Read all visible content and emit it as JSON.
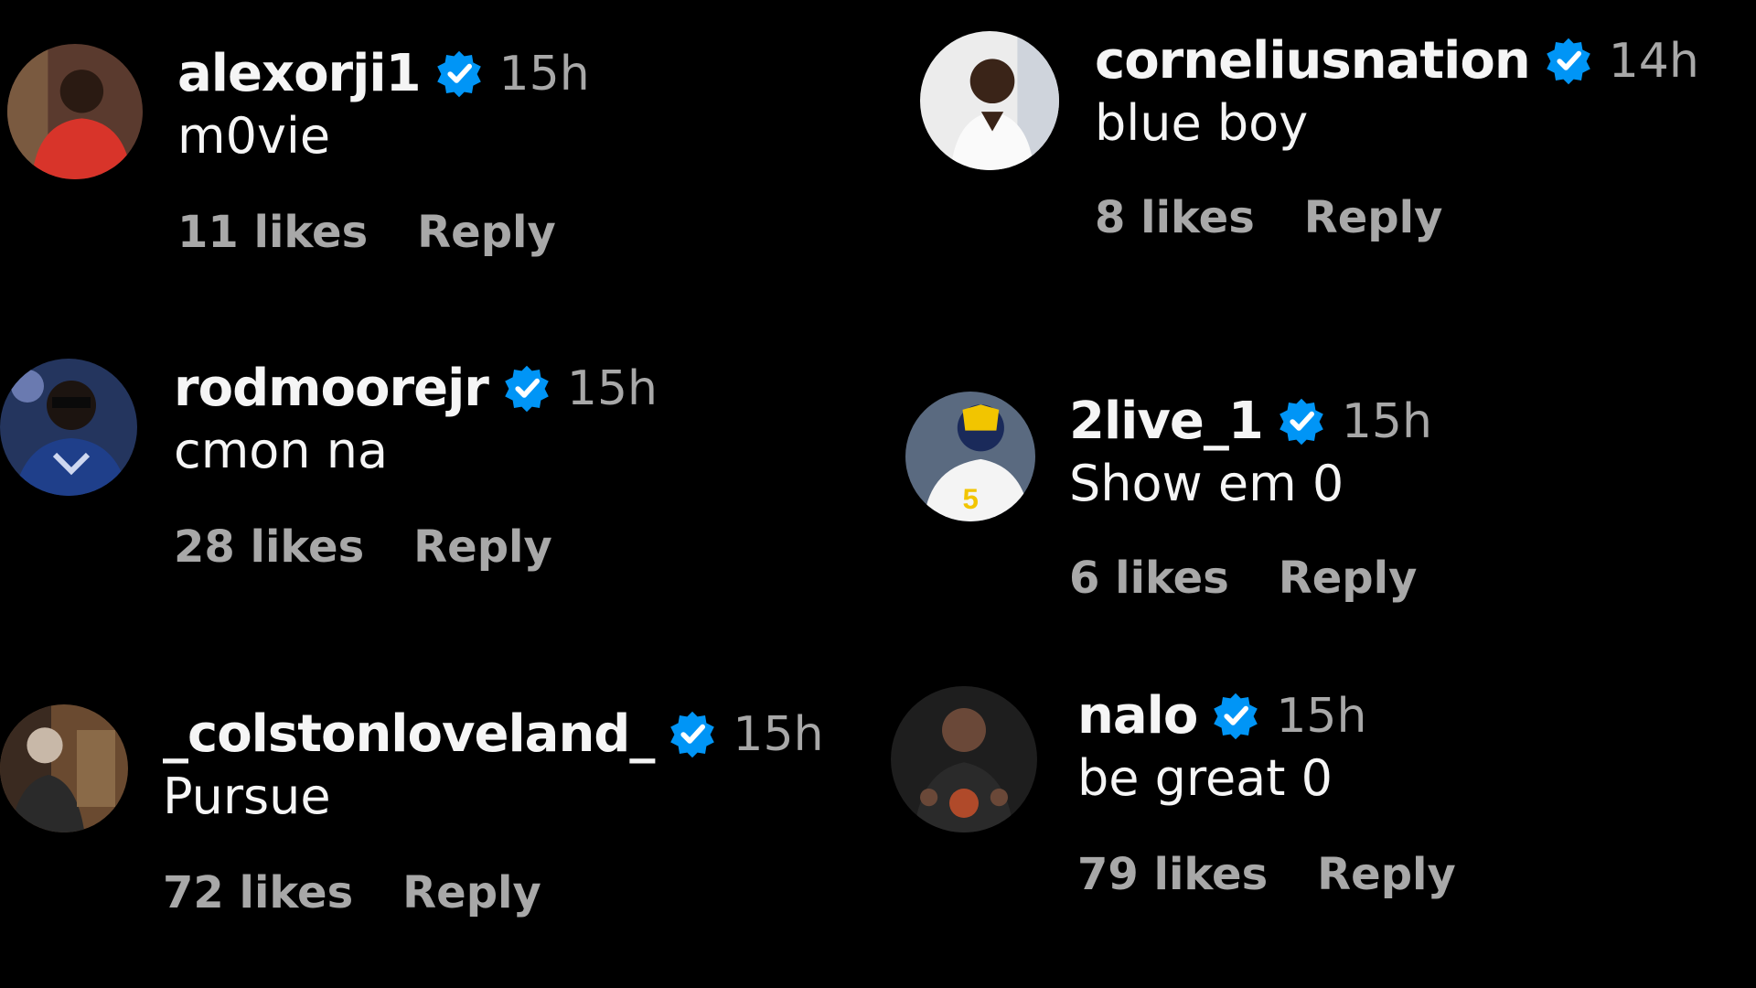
{
  "colors": {
    "background": "#000000",
    "text_primary": "#f5f5f5",
    "text_secondary": "#a8a8a8",
    "verified_blue": "#0095f6"
  },
  "comments": [
    {
      "username": "alexorji1",
      "verified_icon": "verified-badge-icon",
      "time": "15h",
      "text": "m0vie",
      "likes": "11 likes",
      "reply_label": "Reply"
    },
    {
      "username": "rodmoorejr",
      "verified_icon": "verified-badge-icon",
      "time": "15h",
      "text": "cmon na",
      "likes": "28 likes",
      "reply_label": "Reply"
    },
    {
      "username": "_colstonloveland_",
      "verified_icon": "verified-badge-icon",
      "time": "15h",
      "text": "Pursue",
      "likes": "72 likes",
      "reply_label": "Reply"
    },
    {
      "username": "corneliusnation",
      "verified_icon": "verified-badge-icon",
      "time": "14h",
      "text": "blue boy",
      "likes": "8 likes",
      "reply_label": "Reply"
    },
    {
      "username": "2live_1",
      "verified_icon": "verified-badge-icon",
      "time": "15h",
      "text": "Show em 0",
      "likes": "6 likes",
      "reply_label": "Reply"
    },
    {
      "username": "nalo",
      "verified_icon": "verified-badge-icon",
      "time": "15h",
      "text": "be great 0",
      "likes": "79 likes",
      "reply_label": "Reply"
    }
  ]
}
